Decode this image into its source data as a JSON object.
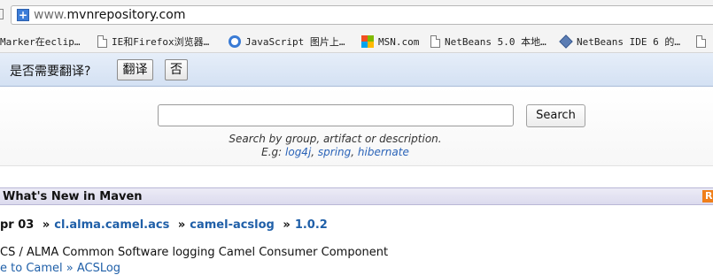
{
  "browser": {
    "url_prefix": "www.",
    "url_domain": "mvnrepository.com"
  },
  "bookmarks": [
    {
      "label": "Marker在eclip…",
      "icon": "none"
    },
    {
      "label": "IE和Firefox浏览器…",
      "icon": "page-icon"
    },
    {
      "label": "JavaScript 图片上…",
      "icon": "javascript-icon"
    },
    {
      "label": "MSN.com",
      "icon": "windows-logo-icon"
    },
    {
      "label": "NetBeans 5.0 本地…",
      "icon": "page-icon"
    },
    {
      "label": "NetBeans IDE 6 的…",
      "icon": "netbeans-icon"
    }
  ],
  "translate_bar": {
    "prompt": "是否需要翻译?",
    "translate_label": "翻译",
    "no_label": "否"
  },
  "search": {
    "value": "",
    "button_label": "Search",
    "hint": "Search by group, artifact or description.",
    "examples_prefix": "E.g: ",
    "examples": [
      "log4j",
      "spring",
      "hibernate"
    ],
    "examples_sep": ", "
  },
  "whats_new": {
    "title": "What's New in Maven",
    "rss_label": "R",
    "date_fragment": "pr 03",
    "group": "cl.alma.camel.acs",
    "artifact": "camel-acslog",
    "version": "1.0.2",
    "separator": "»",
    "description": "CS / ALMA Common Software logging Camel Consumer Component",
    "link_fragment": "e to Camel » ACSLog"
  },
  "colors": {
    "link": "#1f5fa8",
    "translate_bar": "#dbe6f5",
    "section_header": "#e2e1f1",
    "rss": "#f07f1a"
  }
}
